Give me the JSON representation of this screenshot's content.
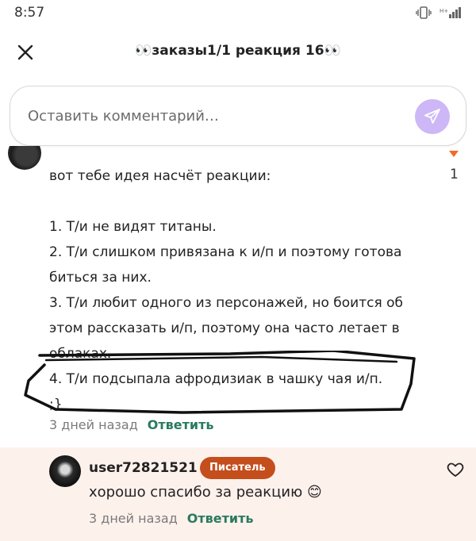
{
  "status": {
    "time": "8:57"
  },
  "header": {
    "title": "👀заказы1/1 реакция 16👀"
  },
  "comment_bar": {
    "placeholder": "Оставить комментарий…"
  },
  "comment": {
    "likes": "1",
    "lines": [
      "вот тебе идея насчёт реакции:",
      "",
      "1. Т/и не видят титаны.",
      "2. Т/и слишком привязана к и/п и поэтому готова",
      "биться за них.",
      "3. Т/и любит одного из персонажей, но боится об",
      "этом рассказать и/п, поэтому она часто летает в",
      "облаках.",
      "4. Т/и подсыпала афродизиак в чашку чая и/п.",
      ";}"
    ],
    "time": "3 дней назад",
    "reply_label": "Ответить"
  },
  "reply": {
    "username": "user72821521",
    "badge": "Писатель",
    "text": "хорошо спасибо  за реакцию 😊",
    "time": "3 дней назад",
    "reply_label": "Ответить"
  },
  "colors": {
    "accent_green": "#2a7a5e",
    "badge_orange": "#c44e1c",
    "send_purple": "#cdb7f7",
    "reply_bg": "#fdf1ec"
  },
  "icons": [
    "vibrate-icon",
    "signal-icon",
    "close-icon",
    "send-icon",
    "like-arrow-icon",
    "heart-icon"
  ]
}
